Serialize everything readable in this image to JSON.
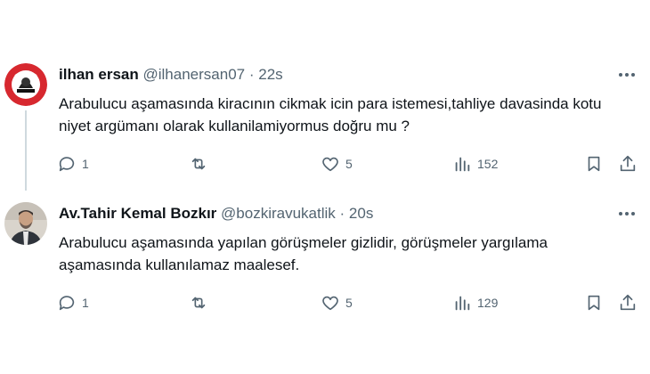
{
  "tweets": [
    {
      "author": "ilhan ersan",
      "handle": "@ilhanersan07",
      "separator": "·",
      "time": "22s",
      "text": "Arabulucu aşamasında kiracının cikmak icin para istemesi,tahliye davasinda kotu niyet argümanı olarak kullanilamiyormus doğru mu ?",
      "replies": "1",
      "reposts": "",
      "likes": "5",
      "views": "152",
      "avatar_icon": "red-circle-logo"
    },
    {
      "author": "Av.Tahir Kemal Bozkır",
      "handle": "@bozkiravukatlik",
      "separator": "·",
      "time": "20s",
      "text": "Arabulucu aşamasında yapılan görüşmeler gizlidir, görüşmeler yargılama aşamasında kullanılamaz maalesef.",
      "replies": "1",
      "reposts": "",
      "likes": "5",
      "views": "129",
      "avatar_icon": "profile-photo"
    }
  ],
  "colors": {
    "text": "#0f1419",
    "muted": "#536471",
    "thread_line": "#cfd9de",
    "logo_red": "#d7282f"
  }
}
